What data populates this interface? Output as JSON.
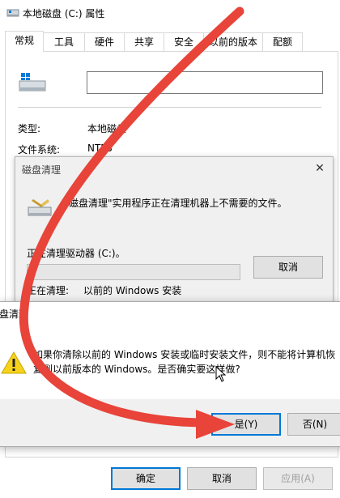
{
  "properties_window": {
    "title": "本地磁盘 (C:) 属性",
    "tabs": [
      "常规",
      "工具",
      "硬件",
      "共享",
      "安全",
      "以前的版本",
      "配额"
    ],
    "active_tab": "常规",
    "name_value": "",
    "type_label": "类型:",
    "type_value": "本地磁盘",
    "fs_label": "文件系统:",
    "fs_value": "NTFS",
    "buttons": {
      "ok": "确定",
      "cancel": "取消",
      "apply": "应用(A)"
    }
  },
  "cleanup_dialog": {
    "title": "磁盘清理",
    "message": "磁盘清理\"实用程序正在清理机器上不需要的文件。",
    "status": "正在清理驱动器 (C:)。",
    "cancel": "取消",
    "cleaning_label": "正在清理:",
    "cleaning_value": "以前的 Windows 安装",
    "progress": 0
  },
  "confirm_dialog": {
    "title": "盘清理",
    "message_line1": "如果你清除以前的 Windows 安装或临时安装文件，则不能将计算机恢",
    "message_line2": "复到以前版本的 Windows。是否确实要这样做?",
    "yes": "是(Y)",
    "no": "否(N)"
  },
  "colors": {
    "arrow": "#e8443a",
    "accent": "#0078d7"
  },
  "icons": [
    "drive-icon",
    "cleanup-icon",
    "warning-icon",
    "close-icon",
    "cursor-icon"
  ]
}
